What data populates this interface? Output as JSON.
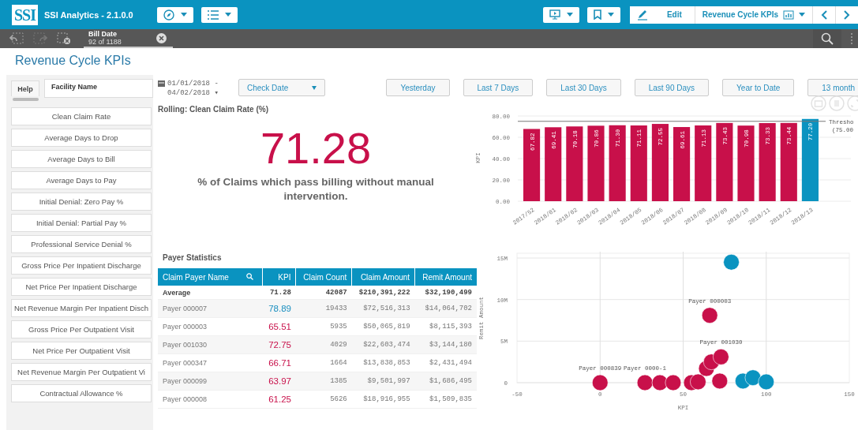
{
  "app": {
    "title": "SSI Analytics - 2.1.0.0",
    "logo": "SSI",
    "edit_label": "Edit",
    "sheet_name": "Revenue Cycle KPIs"
  },
  "selection": {
    "field": "Bill Date",
    "count": "92 of 1188"
  },
  "page_title": "Revenue Cycle KPIs",
  "sidebar": {
    "help_tab": "Help",
    "facility_field": "Facility Name",
    "items": [
      {
        "label": "Clean Claim Rate"
      },
      {
        "label": "Average Days to Drop"
      },
      {
        "label": "Average Days to Bill"
      },
      {
        "label": "Average Days to Pay"
      },
      {
        "label": "Initial Denial: Zero Pay %"
      },
      {
        "label": "Initial Denial: Partial Pay %"
      },
      {
        "label": "Professional Service Denial %"
      },
      {
        "label": "Gross Price Per Inpatient Discharge"
      },
      {
        "label": "Net Price Per Inpatient Discharge"
      },
      {
        "label": "Net Revenue Margin Per Inpatient Disch"
      },
      {
        "label": "Gross Price Per Outpatient Visit"
      },
      {
        "label": "Net Price Per Outpatient Visit"
      },
      {
        "label": "Net Revenue Margin Per Outpatient Vi"
      },
      {
        "label": "Contractual Allowance %"
      }
    ]
  },
  "filters": {
    "date_range": [
      "01/01/2018 -",
      "04/02/2018 ▾"
    ],
    "date_field": "Check Date",
    "quick_buttons": [
      "Yesterday",
      "Last 7 Days",
      "Last 30 Days",
      "Last 90 Days",
      "Year to Date",
      "13 month"
    ]
  },
  "kpi": {
    "title": "Rolling: Clean Claim Rate (%)",
    "value": "71.28",
    "description": "% of Claims which pass billing without manual intervention."
  },
  "bar_chart": {
    "chart_data": {
      "type": "bar",
      "ylabel": "KPI",
      "categories": [
        "2017/52",
        "2018/01",
        "2018/02",
        "2018/03",
        "2018/04",
        "2018/05",
        "2018/06",
        "2018/07",
        "2018/08",
        "2018/09",
        "2018/10",
        "2018/11",
        "2018/12",
        "2018/13"
      ],
      "values": [
        67.82,
        69.41,
        70.18,
        70.86,
        71.3,
        71.11,
        72.55,
        69.61,
        71.13,
        73.43,
        70.98,
        73.33,
        73.44,
        77.2
      ],
      "value_labels": [
        "67.82",
        "69.41",
        "70.18",
        "70.86",
        "71.30",
        "71.11",
        "72.55",
        "69.61",
        "71.13",
        "73.43",
        "70.98",
        "73.33",
        "73.44",
        "77.20"
      ],
      "ylim": [
        0,
        80
      ],
      "yticks": [
        {
          "value": 0,
          "label": "0.00"
        },
        {
          "value": 20,
          "label": "20.00"
        },
        {
          "value": 40,
          "label": "40.00"
        },
        {
          "value": 60,
          "label": "60.00"
        },
        {
          "value": 80,
          "label": "80.00"
        }
      ],
      "grid": true,
      "ref_lines": [
        {
          "axis": "y",
          "value": 75,
          "label": "Thresho (75.00"
        }
      ]
    }
  },
  "table": {
    "title": "Payer Statistics",
    "columns": [
      "Claim Payer Name",
      "KPI",
      "Claim Count",
      "Claim Amount",
      "Remit Amount"
    ],
    "average": [
      "Average",
      "71.28",
      "42087",
      "$210,391,222",
      "$32,190,499"
    ],
    "rows": [
      {
        "cells": [
          "Payer 000007",
          "78.89",
          "19433",
          "$72,516,313",
          "$14,064,702"
        ],
        "color": "#1a8fc0"
      },
      {
        "cells": [
          "Payer 000003",
          "65.51",
          "5935",
          "$50,065,819",
          "$8,115,393"
        ],
        "color": "#c8104a"
      },
      {
        "cells": [
          "Payer 001030",
          "72.75",
          "4029",
          "$22,603,474",
          "$3,144,180"
        ],
        "color": "#c8104a"
      },
      {
        "cells": [
          "Payer 000347",
          "66.71",
          "1664",
          "$13,838,853",
          "$2,431,494"
        ],
        "color": "#c8104a"
      },
      {
        "cells": [
          "Payer 000099",
          "63.97",
          "1385",
          "$9,501,997",
          "$1,686,495"
        ],
        "color": "#c8104a"
      },
      {
        "cells": [
          "Payer 000008",
          "61.25",
          "5626",
          "$18,916,955",
          "$1,509,835"
        ],
        "color": "#c8104a"
      }
    ]
  },
  "scatter": {
    "chart_data": {
      "type": "scatter",
      "grid": true,
      "xlabel": "KPI",
      "ylabel": "Remit Amount",
      "xlim": [
        -50,
        150
      ],
      "ylim": [
        0,
        15000000
      ],
      "xticks": [
        -50,
        0,
        50,
        100,
        150
      ],
      "yticks": [
        {
          "value": 0,
          "label": "0"
        },
        {
          "value": 5000000,
          "label": "5M"
        },
        {
          "value": 10000000,
          "label": "10M"
        },
        {
          "value": 15000000,
          "label": "15M"
        }
      ],
      "series": [
        {
          "color": "#c8104a",
          "x": [
            0,
            27,
            36,
            44,
            55,
            59,
            64,
            67,
            66,
            72.75,
            72
          ],
          "values": [
            0,
            0,
            0,
            0,
            0,
            100000,
            1700000,
            2500000,
            8100000,
            3100000,
            200000
          ]
        },
        {
          "color": "#0a93c0",
          "x": [
            79,
            86,
            92,
            100
          ],
          "values": [
            14500000,
            200000,
            600000,
            100000
          ]
        }
      ],
      "annotations": [
        {
          "x": 0,
          "y": 0,
          "text": "Payer 000839"
        },
        {
          "x": 27,
          "y": 0,
          "text": "Payer 0000-1"
        },
        {
          "x": 66,
          "y": 8100000,
          "text": "Payer 000003"
        },
        {
          "x": 72.75,
          "y": 3100000,
          "text": "Payer 001030"
        }
      ]
    }
  }
}
